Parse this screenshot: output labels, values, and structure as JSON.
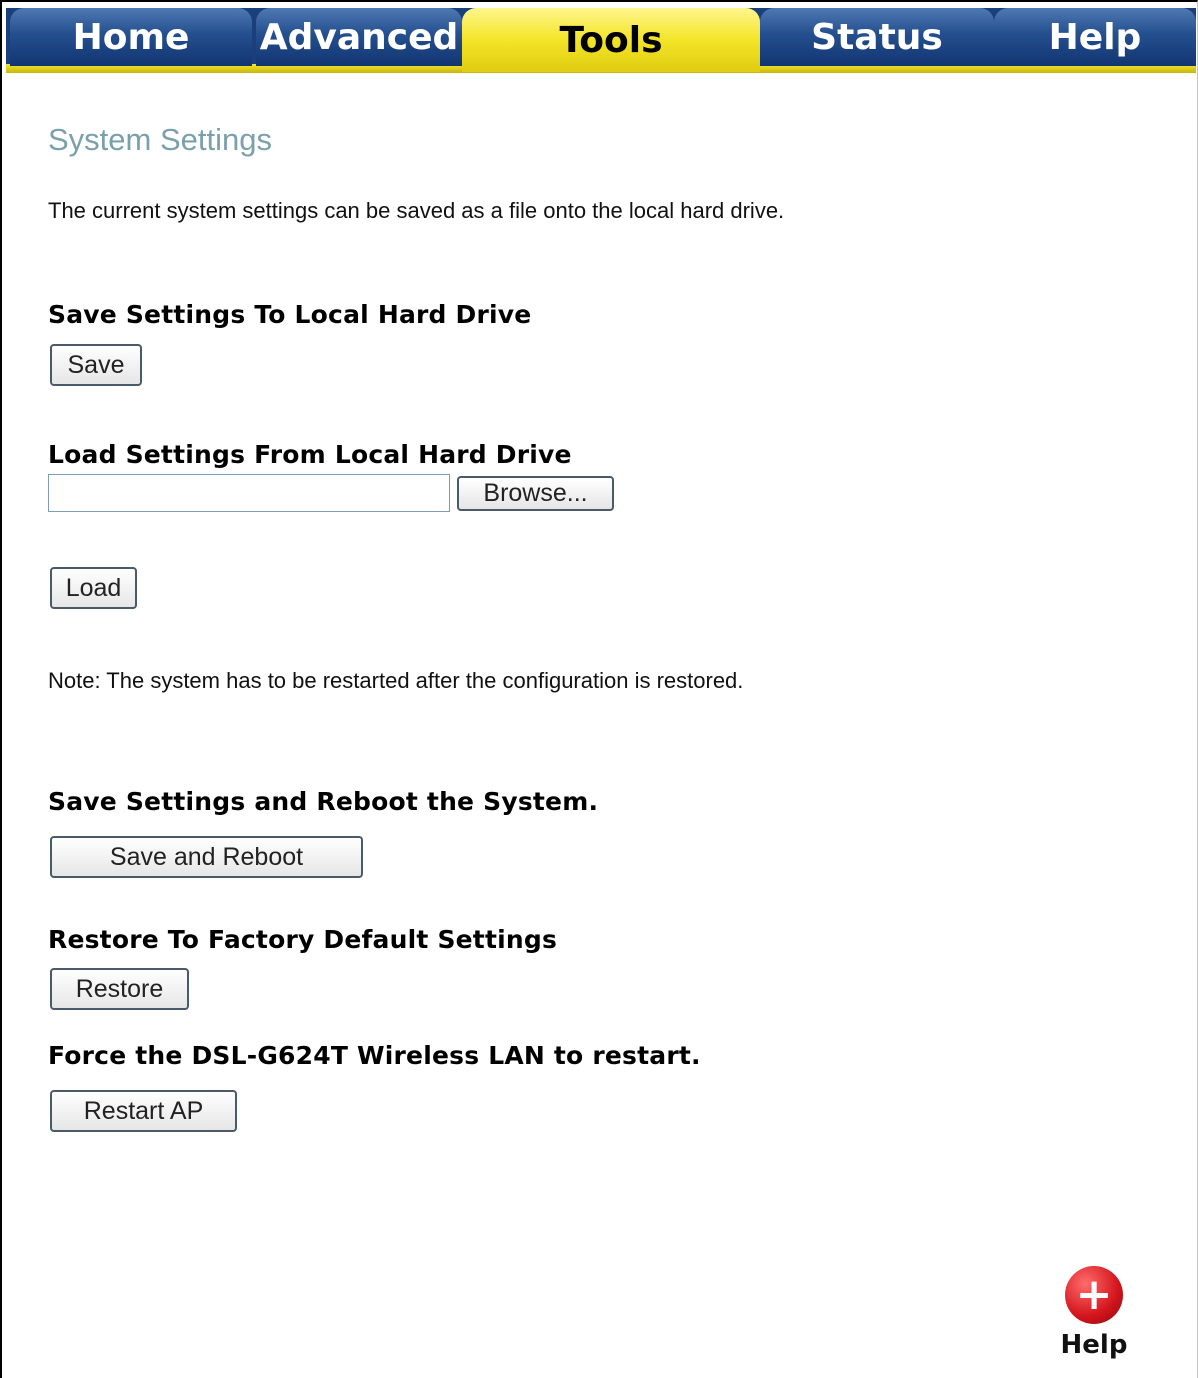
{
  "nav": {
    "tabs": [
      {
        "label": "Home",
        "active": false
      },
      {
        "label": "Advanced",
        "active": false
      },
      {
        "label": "Tools",
        "active": true
      },
      {
        "label": "Status",
        "active": false
      },
      {
        "label": "Help",
        "active": false
      }
    ]
  },
  "page": {
    "title": "System Settings",
    "description": "The current system settings can be saved as a file onto the local hard drive."
  },
  "save_section": {
    "heading": "Save Settings To Local Hard Drive",
    "button": "Save"
  },
  "load_section": {
    "heading": "Load Settings From Local Hard Drive",
    "file_value": "",
    "browse_button": "Browse...",
    "load_button": "Load",
    "note": "Note: The system has to be restarted after the configuration is restored."
  },
  "reboot_section": {
    "heading": "Save Settings and Reboot the System.",
    "button": "Save and Reboot"
  },
  "restore_section": {
    "heading": "Restore To Factory Default Settings",
    "button": "Restore"
  },
  "restart_section": {
    "heading": "Force the DSL-G624T Wireless LAN to restart.",
    "button": "Restart AP"
  },
  "help_widget": {
    "label": "Help",
    "icon": "plus-icon"
  },
  "colors": {
    "nav_blue": "#1a3f7a",
    "nav_active_yellow": "#f3e427",
    "title": "#7aa0ac",
    "help_red": "#d3141c"
  }
}
